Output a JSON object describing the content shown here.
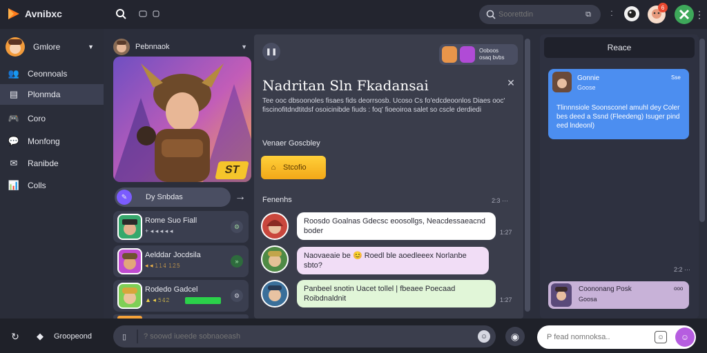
{
  "app": {
    "name": "Avnibxc"
  },
  "header": {
    "search_placeholder": "Soorettdin",
    "notification_count": "6",
    "toolbar_icons": [
      "search-icon",
      "grid-icon"
    ]
  },
  "sidebar": {
    "user": "Gmlore",
    "items": [
      {
        "label": "Ceonnoals",
        "icon": "users-icon"
      },
      {
        "label": "Plonmda",
        "icon": "inbox-icon"
      },
      {
        "label": "Coro",
        "icon": "gamepad-icon"
      },
      {
        "label": "Monfong",
        "icon": "chat-icon"
      },
      {
        "label": "Ranibde",
        "icon": "mail-icon"
      },
      {
        "label": "Colls",
        "icon": "chart-icon"
      }
    ]
  },
  "feature": {
    "header_user": "Pebnnaok",
    "banner_badge": "ST",
    "pill_label": "Dy Snbdas"
  },
  "friends": [
    {
      "name": "Rome Suo Fiall",
      "meta": "+ ◂ ◂ ◂ ◂ ◂"
    },
    {
      "name": "Aelddar Jocdsila",
      "meta": "◂ ◂ 𝟷𝟷𝟺 𝟷𝟸𝟻"
    },
    {
      "name": "Rodedo Gadcel",
      "meta": "▲ ◂ 𝟻𝟺𝟸"
    }
  ],
  "center": {
    "participants_label": "Ooboos\nosaq bvbs",
    "title": "Nadritan Sln Fkadansai",
    "description": "Tee ooc dbsoonoles fisaes fids deorrsosb. Ucoso Cs fo'edcdeoonlos Diaes ooc' fiscinofitdndtitdsf osoicinibde fiuds : foq' fioeoiroa salet so cscle derdiedi",
    "section_label": "Venaer Goscbley",
    "action_button": "Stcofio",
    "messages_label": "Fenenhs",
    "messages_time": "2:3 ⋯",
    "messages": [
      {
        "text": "Roosdo Goalnas Gdecsc eoosollgs, Neacdessaeacnd boder",
        "time": "1:27",
        "color": "#ffffff"
      },
      {
        "text": "Naovaeaie be 😊 Roedl ble aoedleeex Norlanbe sbto?",
        "time": "",
        "color": "#f1ddf6"
      },
      {
        "text": "Panbeel snotin Uacet tollel | fbeaee Poecaad Roibdnaldnit",
        "time": "1:27",
        "color": "#e1f6d8"
      }
    ]
  },
  "right_panel": {
    "header": "Reace",
    "card1": {
      "name": "Gonnie",
      "sub": "Goose",
      "time": "Sse",
      "text": "Tlinnnsiole Soonsconel amuhl dey Coler bes deed a Ssnd (Fleedeng) Isuger pind eed lndeonl)"
    },
    "card2": {
      "name": "Coononang Posk",
      "sub": "Goosa",
      "time": "ooo",
      "time_above": "2:2 ⋯"
    }
  },
  "bottom": {
    "left_label": "Groopeond",
    "compose_placeholder": "? soowd iueede sobnaoeash",
    "reply_placeholder": "P fead nomnoksa.."
  },
  "colors": {
    "accent": "#7b5cff",
    "primary_button": "#f5b821",
    "bubble_blue": "#4c8ef0",
    "badge_red": "#e8482f"
  }
}
